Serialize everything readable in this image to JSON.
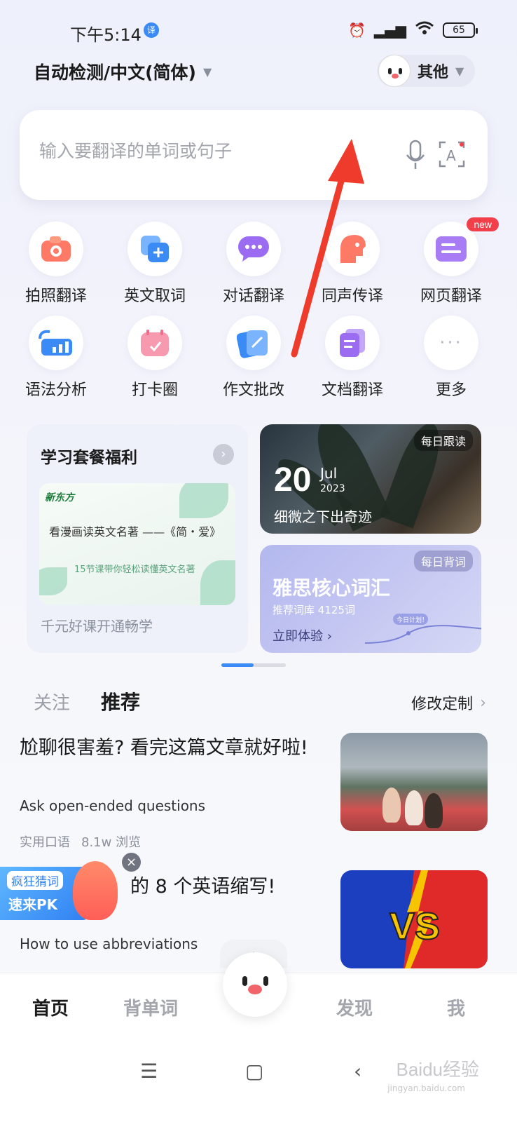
{
  "status": {
    "time": "下午5:14",
    "app_badge": "译",
    "battery": "65"
  },
  "header": {
    "language": "自动检测/中文(简体)",
    "other_label": "其他"
  },
  "search": {
    "placeholder": "输入要翻译的单词或句子"
  },
  "features": [
    {
      "label": "拍照翻译",
      "icon": "camera-icon",
      "color": "#ff7a66"
    },
    {
      "label": "英文取词",
      "icon": "add-word-icon",
      "color": "#3a8bf5"
    },
    {
      "label": "对话翻译",
      "icon": "chat-icon",
      "color": "#9b6cf2"
    },
    {
      "label": "同声传译",
      "icon": "simultaneous-icon",
      "color": "#ff7a66"
    },
    {
      "label": "网页翻译",
      "icon": "webpage-icon",
      "color": "#a77cf5",
      "badge": "new"
    },
    {
      "label": "语法分析",
      "icon": "chart-icon",
      "color": "#3a8bf5"
    },
    {
      "label": "打卡圈",
      "icon": "calendar-icon",
      "color": "#f36b8b"
    },
    {
      "label": "作文批改",
      "icon": "edit-icon",
      "color": "#3a8bf5"
    },
    {
      "label": "文档翻译",
      "icon": "document-icon",
      "color": "#9b6cf2"
    },
    {
      "label": "更多",
      "icon": "more-icon",
      "color": "#b7bac4"
    }
  ],
  "promo": {
    "left": {
      "title": "学习套餐福利",
      "banner_logo": "新东方",
      "banner_line1": "看漫画读英文名著 ——《简・爱》",
      "banner_line2": "15节课带你轻松读懂英文名著",
      "subtitle": "千元好课开通畅学"
    },
    "right_top": {
      "tag": "每日跟读",
      "day": "20",
      "month": "Jul",
      "year": "2023",
      "caption": "细微之下出奇迹"
    },
    "right_bottom": {
      "tag": "每日背词",
      "title": "雅思核心词汇",
      "subtitle": "推荐词库 4125词",
      "cta": "立即体验 ›",
      "chart_label": "今日计划！"
    }
  },
  "feed": {
    "tab_follow": "关注",
    "tab_recommend": "推荐",
    "customize": "修改定制",
    "articles": [
      {
        "title": "尬聊很害羞? 看完这篇文章就好啦!",
        "subtitle": "Ask open-ended questions",
        "category": "实用口语",
        "views": "8.1w 浏览"
      },
      {
        "title": "的 8 个英语缩写!",
        "subtitle": "How to use abbreviations"
      }
    ]
  },
  "float_ad": {
    "line1": "疯狂猜词",
    "line2": "速来PK"
  },
  "bottom_nav": {
    "home": "首页",
    "vocab": "背单词",
    "discover": "发现",
    "me": "我"
  },
  "watermark": {
    "main": "Baidu经验",
    "sub": "jingyan.baidu.com"
  }
}
